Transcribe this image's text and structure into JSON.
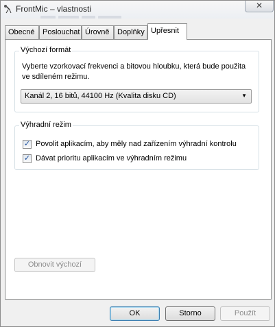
{
  "window": {
    "title": "FrontMic – vlastnosti",
    "close_glyph": "✕"
  },
  "tabs": [
    {
      "label": "Obecné"
    },
    {
      "label": "Poslouchat"
    },
    {
      "label": "Úrovně"
    },
    {
      "label": "Doplňky"
    },
    {
      "label": "Upřesnit",
      "active": true
    }
  ],
  "default_format": {
    "legend": "Výchozí formát",
    "description": "Vyberte vzorkovací frekvenci a bitovou hloubku, která bude použita ve sdíleném režimu.",
    "selected": "Kanál 2, 16 bitů, 44100 Hz (Kvalita disku CD)"
  },
  "exclusive_mode": {
    "legend": "Výhradní režim",
    "options": [
      {
        "label": "Povolit aplikacím, aby měly nad zařízením výhradní kontrolu",
        "checked": true
      },
      {
        "label": "Dávat prioritu aplikacím ve výhradním režimu",
        "checked": true
      }
    ]
  },
  "reset_button": "Obnovit výchozí",
  "buttons": {
    "ok": "OK",
    "cancel": "Storno",
    "apply": "Použít"
  },
  "colors": {
    "accent": "#3c7fb1",
    "check": "#1c4f9c"
  }
}
